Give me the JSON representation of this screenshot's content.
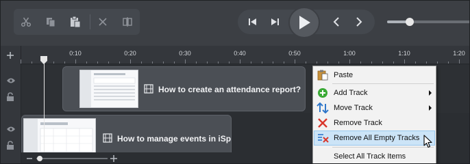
{
  "toolbar": {
    "edit_buttons": [
      {
        "name": "cut",
        "icon": "scissors-icon"
      },
      {
        "name": "copy",
        "icon": "copy-icon"
      },
      {
        "name": "paste",
        "icon": "paste-icon"
      }
    ],
    "clip_buttons": [
      {
        "name": "delete",
        "icon": "x-icon"
      },
      {
        "name": "split",
        "icon": "split-icon"
      }
    ],
    "playback_buttons": [
      "step-back-icon",
      "step-forward-icon",
      "play-icon",
      "previous-icon",
      "next-icon"
    ],
    "zoom_slider_level": 0.27
  },
  "ruler": {
    "ticks": [
      "0:10",
      "0:20",
      "0:30",
      "0:40",
      "0:50",
      "1:00",
      "1:10",
      "1:20"
    ]
  },
  "clips": [
    {
      "title": "How to create an attendance report?"
    },
    {
      "title": "How to manage events in iSp"
    }
  ],
  "context_menu": {
    "items": [
      {
        "label": "Paste",
        "icon": "paste-icon",
        "submenu": false
      },
      {
        "label": "Add Track",
        "icon": "add-circle-icon",
        "submenu": true
      },
      {
        "label": "Move Track",
        "icon": "move-arrows-icon",
        "submenu": true
      },
      {
        "label": "Remove Track",
        "icon": "remove-x-icon",
        "submenu": false
      },
      {
        "label": "Remove All Empty Tracks",
        "icon": "remove-empty-tracks-icon",
        "submenu": false,
        "highlighted": true
      },
      {
        "label": "Select All Track Items",
        "icon": "",
        "submenu": false
      }
    ]
  },
  "colors": {
    "toolbar_bg": "#3c3f44",
    "timeline_bg": "#2b2e32",
    "menu_bg": "#f2f2f2",
    "menu_highlight": "#cce4f7",
    "add_green": "#3aa935",
    "remove_red": "#d9362b",
    "move_blue": "#2f77c9"
  }
}
